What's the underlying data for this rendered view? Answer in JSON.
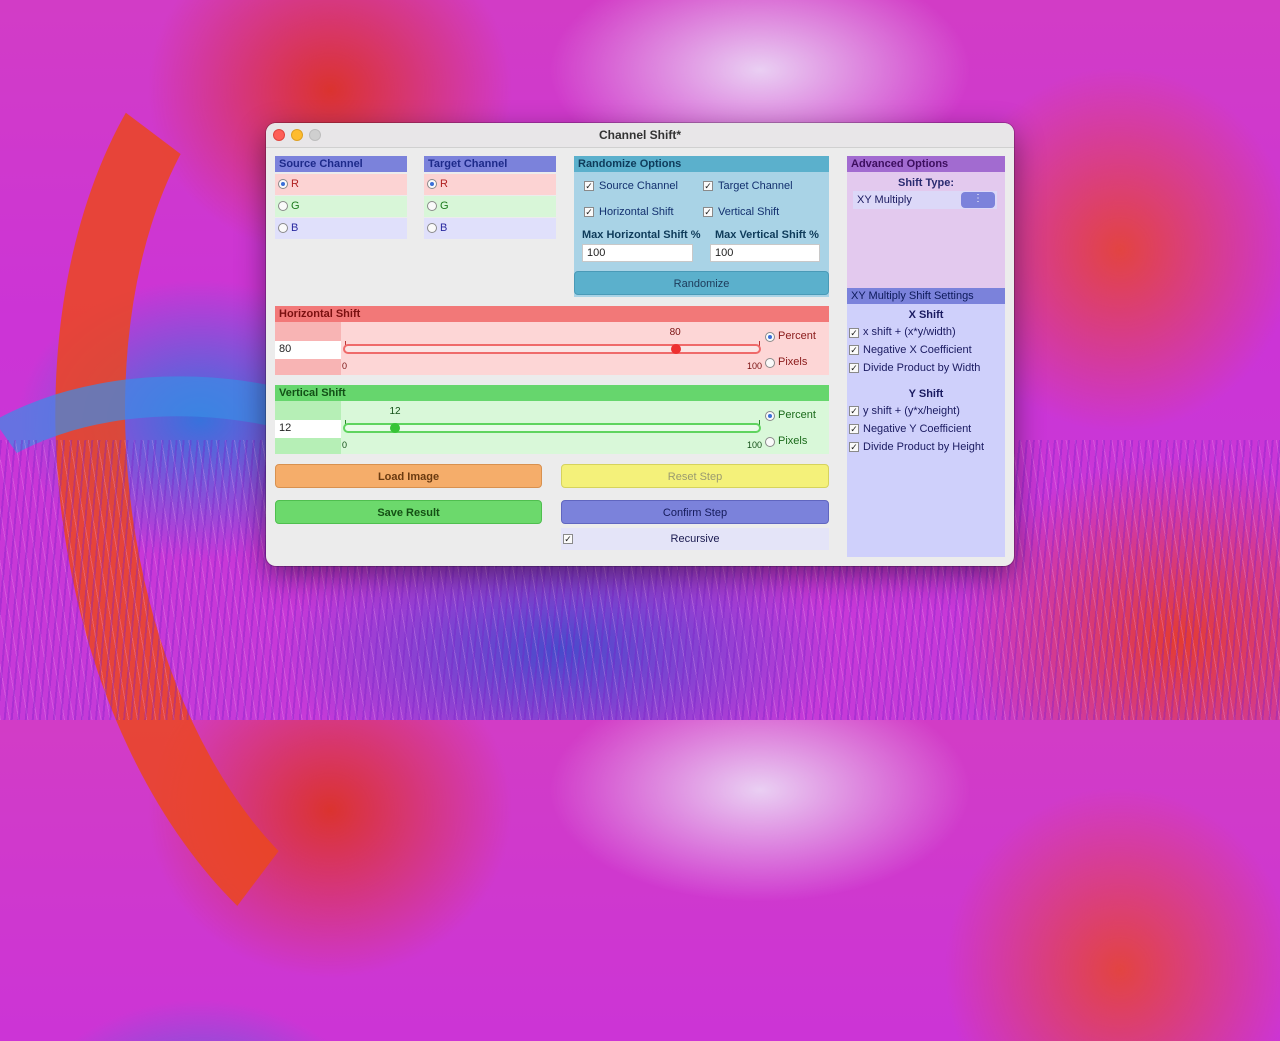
{
  "window": {
    "title": "Channel Shift*"
  },
  "source_channel": {
    "header": "Source Channel",
    "options": [
      "R",
      "G",
      "B"
    ],
    "selected": "R"
  },
  "target_channel": {
    "header": "Target Channel",
    "options": [
      "R",
      "G",
      "B"
    ],
    "selected": "R"
  },
  "randomize": {
    "header": "Randomize Options",
    "source_channel_label": "Source Channel",
    "target_channel_label": "Target Channel",
    "horizontal_shift_label": "Horizontal Shift",
    "vertical_shift_label": "Vertical Shift",
    "max_h_label": "Max Horizontal Shift %",
    "max_v_label": "Max Vertical Shift %",
    "max_h_value": "100",
    "max_v_value": "100",
    "button": "Randomize"
  },
  "horizontal_shift": {
    "header": "Horizontal Shift",
    "value": "80",
    "slider_value": 80,
    "slider_min": "0",
    "slider_max": "100",
    "slider_value_label": "80",
    "unit_options": [
      "Percent",
      "Pixels"
    ],
    "selected_unit": "Percent"
  },
  "vertical_shift": {
    "header": "Vertical Shift",
    "value": "12",
    "slider_value": 12,
    "slider_min": "0",
    "slider_max": "100",
    "slider_value_label": "12",
    "unit_options": [
      "Percent",
      "Pixels"
    ],
    "selected_unit": "Percent"
  },
  "actions": {
    "load_image": "Load Image",
    "reset_step": "Reset Step",
    "save_result": "Save Result",
    "confirm_step": "Confirm Step",
    "recursive": "Recursive"
  },
  "advanced": {
    "header": "Advanced Options",
    "shift_type_label": "Shift Type:",
    "shift_type_value": "XY Multiply"
  },
  "xy_settings": {
    "header": "XY Multiply Shift Settings",
    "x_title": "X Shift",
    "x_options": [
      "x shift + (x*y/width)",
      "Negative X Coefficient",
      "Divide Product by Width"
    ],
    "y_title": "Y Shift",
    "y_options": [
      "y shift + (y*x/height)",
      "Negative Y Coefficient",
      "Divide Product by Height"
    ]
  },
  "colors": {
    "red_accent": "#f27878",
    "green_accent": "#66d66d",
    "blue_accent": "#7b82db",
    "teal_accent": "#5bb0cc",
    "purple_accent": "#a26bd0"
  }
}
